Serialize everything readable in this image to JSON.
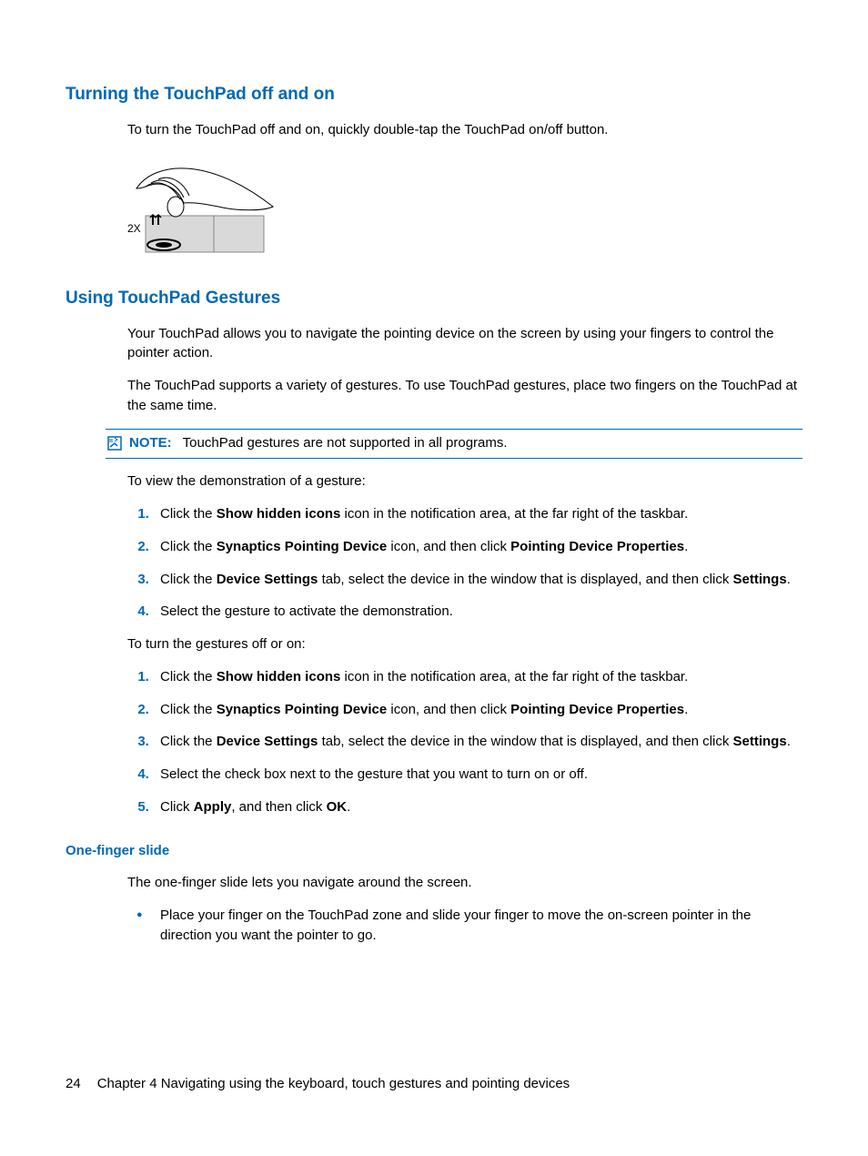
{
  "section1": {
    "heading": "Turning the TouchPad off and on",
    "p1": "To turn the TouchPad off and on, quickly double-tap the TouchPad on/off button."
  },
  "section2": {
    "heading": "Using TouchPad Gestures",
    "p1": "Your TouchPad allows you to navigate the pointing device on the screen by using your fingers to control the pointer action.",
    "p2": "The TouchPad supports a variety of gestures. To use TouchPad gestures, place two fingers on the TouchPad at the same time.",
    "noteLabel": "NOTE:",
    "noteText": "TouchPad gestures are not supported in all programs.",
    "p3": "To view the demonstration of a gesture:",
    "listA": {
      "i1a": "Click the ",
      "i1b": "Show hidden icons",
      "i1c": " icon in the notification area, at the far right of the taskbar.",
      "i2a": "Click the ",
      "i2b": "Synaptics Pointing Device",
      "i2c": " icon, and then click ",
      "i2d": "Pointing Device Properties",
      "i2e": ".",
      "i3a": "Click the ",
      "i3b": "Device Settings",
      "i3c": " tab, select the device in the window that is displayed, and then click ",
      "i3d": "Settings",
      "i3e": ".",
      "i4": "Select the gesture to activate the demonstration."
    },
    "p4": "To turn the gestures off or on:",
    "listB": {
      "i1a": "Click the ",
      "i1b": "Show hidden icons",
      "i1c": " icon in the notification area, at the far right of the taskbar.",
      "i2a": "Click the ",
      "i2b": "Synaptics Pointing Device",
      "i2c": " icon, and then click ",
      "i2d": "Pointing Device Properties",
      "i2e": ".",
      "i3a": "Click the ",
      "i3b": "Device Settings",
      "i3c": " tab, select the device in the window that is displayed, and then click ",
      "i3d": "Settings",
      "i3e": ".",
      "i4": "Select the check box next to the gesture that you want to turn on or off.",
      "i5a": "Click ",
      "i5b": "Apply",
      "i5c": ", and then click ",
      "i5d": "OK",
      "i5e": "."
    }
  },
  "section3": {
    "heading": "One-finger slide",
    "p1": "The one-finger slide lets you navigate around the screen.",
    "bullet1": "Place your finger on the TouchPad zone and slide your finger to move the on-screen pointer in the direction you want the pointer to go."
  },
  "footer": {
    "page": "24",
    "chapter": "Chapter 4   Navigating using the keyboard, touch gestures and pointing devices"
  }
}
